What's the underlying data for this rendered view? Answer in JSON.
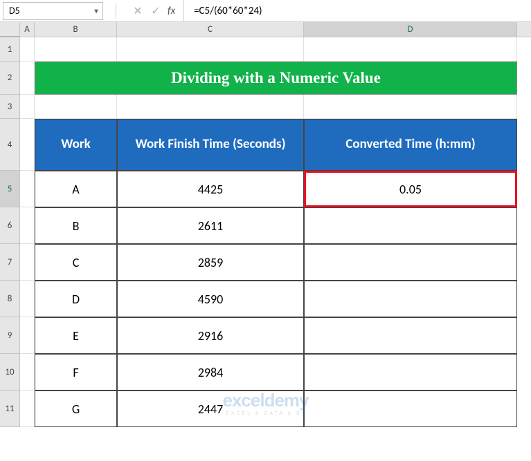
{
  "nameBox": "D5",
  "formula": "=C5/(60*60*24)",
  "columns": {
    "A": "A",
    "B": "B",
    "C": "C",
    "D": "D"
  },
  "rows": [
    "1",
    "2",
    "3",
    "4",
    "5",
    "6",
    "7",
    "8",
    "9",
    "10",
    "11"
  ],
  "title": "Dividing with a Numeric Value",
  "headers": {
    "work": "Work",
    "finish": "Work Finish Time (Seconds)",
    "converted": "Converted Time (h:mm)"
  },
  "data": [
    {
      "work": "A",
      "seconds": "4425",
      "converted": "0.05"
    },
    {
      "work": "B",
      "seconds": "2611",
      "converted": ""
    },
    {
      "work": "C",
      "seconds": "2859",
      "converted": ""
    },
    {
      "work": "D",
      "seconds": "4590",
      "converted": ""
    },
    {
      "work": "E",
      "seconds": "2916",
      "converted": ""
    },
    {
      "work": "F",
      "seconds": "2984",
      "converted": ""
    },
    {
      "work": "G",
      "seconds": "2447",
      "converted": ""
    }
  ],
  "watermark": {
    "main": "exceldemy",
    "sub": "EXCEL & DATA & BI"
  }
}
